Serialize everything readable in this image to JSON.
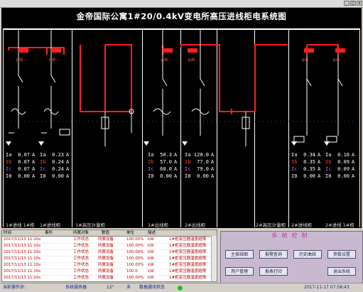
{
  "window": {
    "minimize_glyph": "_",
    "maximize_glyph": "□",
    "close_glyph": "x"
  },
  "title": "金帝国际公寓1#20/0.4kV变电所高压进线柜电系统图",
  "colors": {
    "bus": "#ffffff",
    "live": "#ff2020",
    "breaker_indicator": "#ff1e1e",
    "ia": "#ffffff",
    "ib": "#ff4040",
    "ic": "#c060ff"
  },
  "feeders": [
    {
      "indicator": "合闸",
      "ia": "0.07",
      "ib": "0.07",
      "ic": "0.07",
      "i0": "0.00",
      "unit": "A"
    },
    {
      "indicator": "合闸",
      "ia": "0.23",
      "ib": "0.24",
      "ic": "0.24",
      "i0": "0.00",
      "unit": "A"
    },
    {
      "indicator": "",
      "ia": "",
      "ib": "",
      "ic": "",
      "i0": "",
      "unit": ""
    },
    {
      "indicator": "合闸",
      "ia": "50.3",
      "ib": "57.0",
      "ic": "60.0",
      "i0": "0.00",
      "unit": "A"
    },
    {
      "indicator": "合闸",
      "ia": "120.0",
      "ib": "77.0",
      "ic": "79.0",
      "i0": "0.00",
      "unit": "A"
    },
    {
      "indicator": "",
      "ia": "",
      "ib": "",
      "ic": "",
      "i0": "",
      "unit": ""
    },
    {
      "indicator": "合闸",
      "ia": "0.34",
      "ib": "0.35",
      "ic": "0.35",
      "i0": "0.00",
      "unit": "A"
    },
    {
      "indicator": "合闸",
      "ia": "0.10",
      "ib": "0.09",
      "ic": "0.09",
      "i0": "0.00",
      "unit": "A"
    }
  ],
  "feeder_names": [
    "1#进线 1#柜",
    "1#进线柜",
    "1#高压计量柜",
    "1#出线柜",
    "2#出线柜",
    "2#高压计量柜",
    "2#进线柜",
    "2#进线 1#柜"
  ],
  "event_table": {
    "headers": [
      "时间",
      "事件",
      "所属对象",
      "数值",
      "单位",
      "描述"
    ],
    "rows": [
      [
        "2017/11/13 11:10s",
        "工作状态",
        "所属设备",
        "100.00%",
        "kW",
        "1#柜变压器温度超限"
      ],
      [
        "2017/11/13 11:10s",
        "工作状态",
        "所属设备",
        "100.00%",
        "kW",
        "1#柜变压器温度超限"
      ],
      [
        "2017/11/13 11:10s",
        "工作状态",
        "所属设备",
        "100.00%",
        "kW",
        "1#柜变压器温度超限"
      ],
      [
        "2017/11/13 11:10s",
        "工作状态",
        "所属设备",
        "100.00%",
        "kW",
        "1#柜变压器温度超限"
      ],
      [
        "2017/11/13 11:10s",
        "工作状态",
        "所属设备",
        "100.00%",
        "kW",
        "1#柜变压器温度超限"
      ],
      [
        "2017/11/13 11:10s",
        "工作状态",
        "所属设备",
        "100.0",
        "kW",
        "1#柜变压器温度超限"
      ],
      [
        "2017/11/13 11:10s",
        "工作状态",
        "所属设备",
        "100.00%",
        "kW",
        "1#柜变压器温度超限"
      ]
    ]
  },
  "control_panel": {
    "title": "系统控制",
    "buttons": [
      "主接线图",
      "报警查询",
      "历史曲线",
      "参数设置",
      "用户管理",
      "报表打印",
      "退出系统"
    ]
  },
  "status": {
    "operator": "当前操作员：",
    "server": "系统服务器",
    "temperature": "12°",
    "connection": "未",
    "comm_label": "数据通讯状态",
    "datetime": "2017-11-17  07:58:43"
  }
}
